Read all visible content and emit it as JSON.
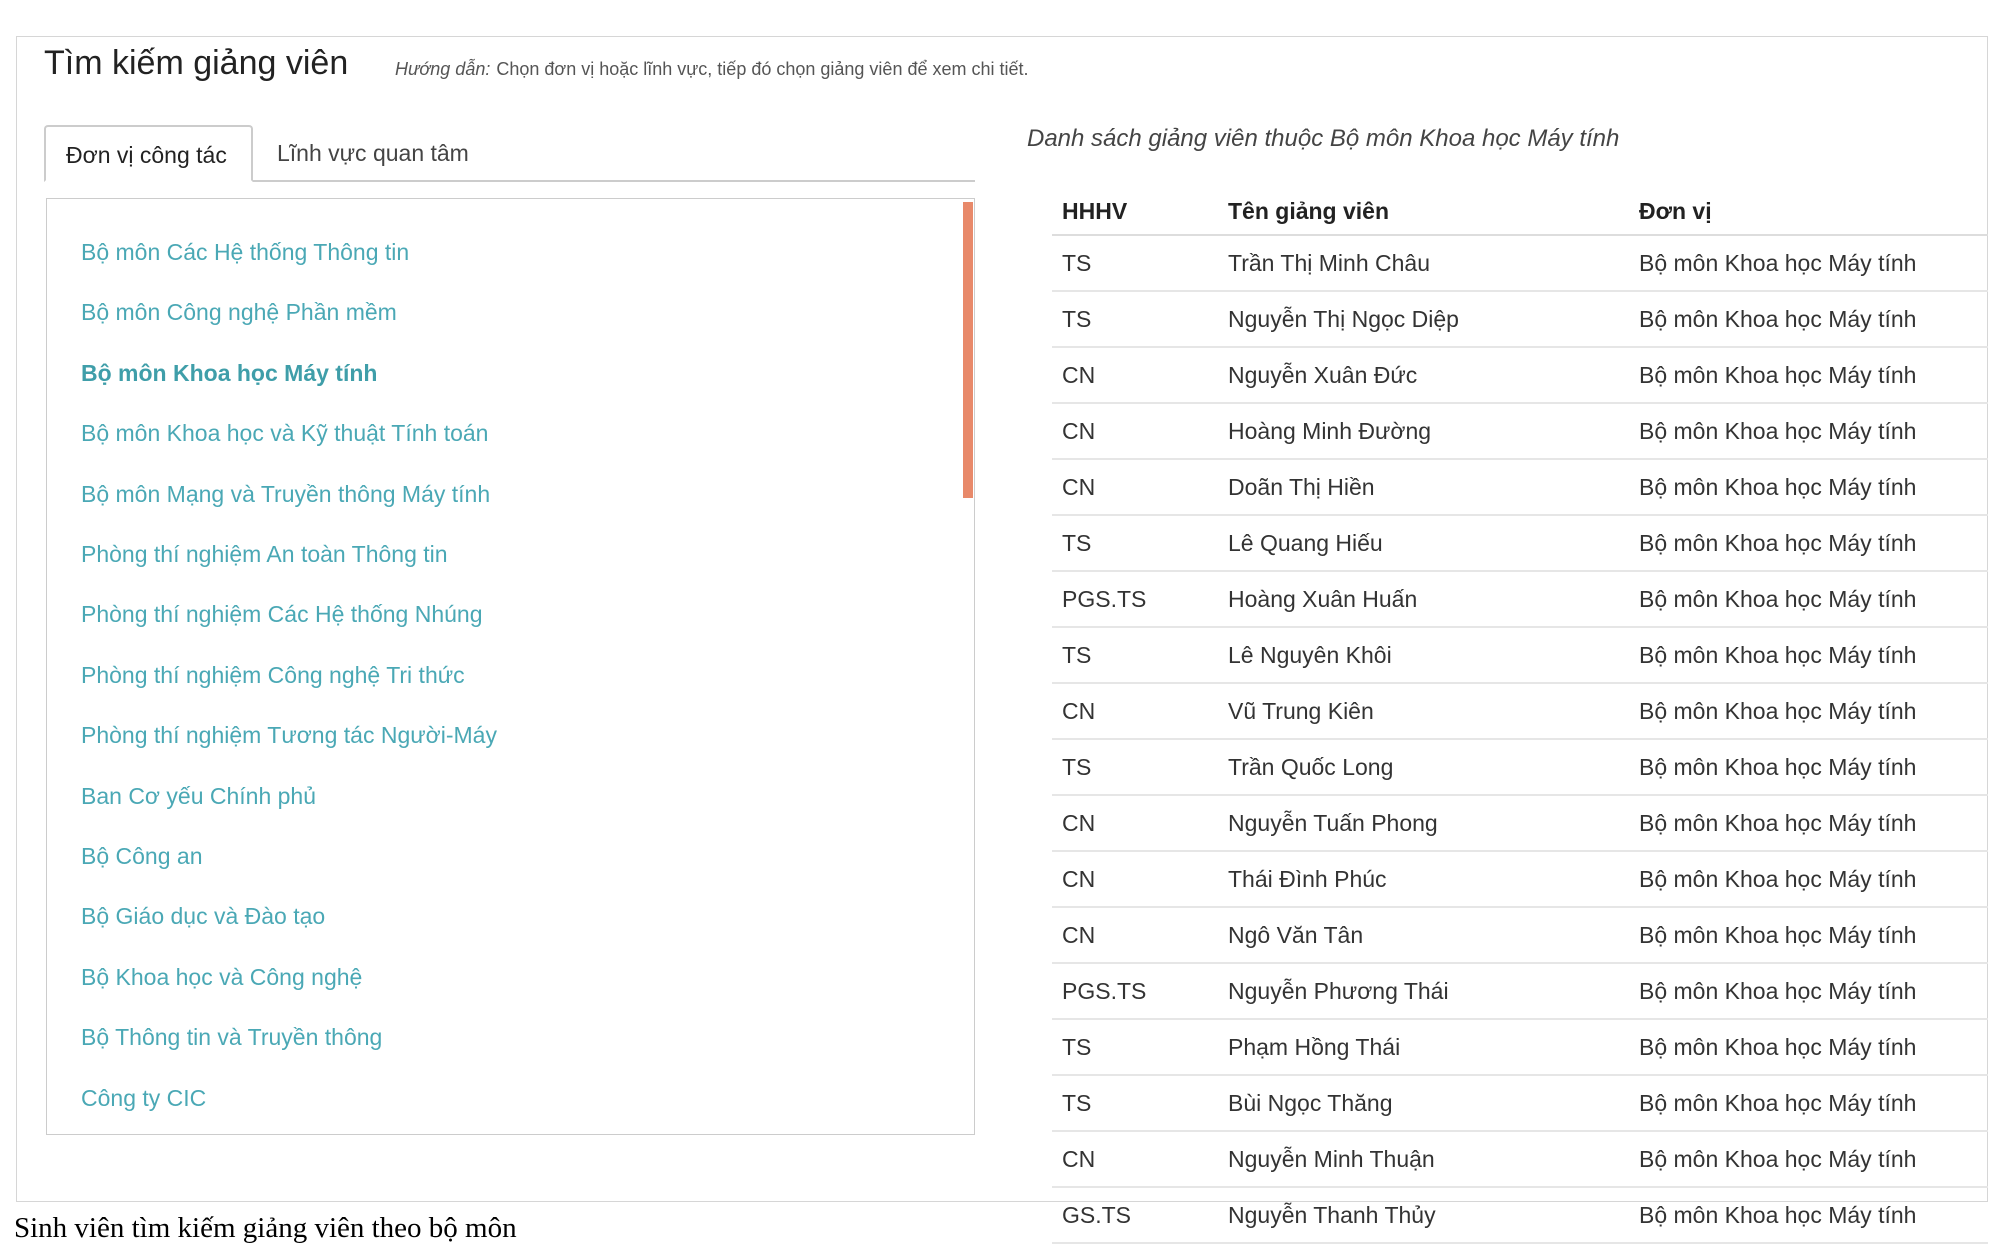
{
  "header": {
    "title": "Tìm kiếm giảng viên",
    "hint_label": "Hướng dẫn:",
    "hint_text": "Chọn đơn vị hoặc lĩnh vực, tiếp đó chọn giảng viên để xem chi tiết."
  },
  "tabs": [
    {
      "label": "Đơn vị công tác",
      "active": true
    },
    {
      "label": "Lĩnh vực quan tâm",
      "active": false
    }
  ],
  "units": [
    "Bộ môn Các Hệ thống Thông tin",
    "Bộ môn Công nghệ Phần mềm",
    "Bộ môn Khoa học Máy tính",
    "Bộ môn Khoa học và Kỹ thuật Tính toán",
    "Bộ môn Mạng và Truyền thông Máy tính",
    "Phòng thí nghiệm An toàn Thông tin",
    "Phòng thí nghiệm Các Hệ thống Nhúng",
    "Phòng thí nghiệm Công nghệ Tri thức",
    "Phòng thí nghiệm Tương tác Người-Máy",
    "Ban Cơ yếu Chính phủ",
    "Bộ Công an",
    "Bộ Giáo dục và Đào tạo",
    "Bộ Khoa học và Công nghệ",
    "Bộ Thông tin và Truyền thông",
    "Công ty CIC"
  ],
  "selected_unit": "Bộ môn Khoa học Máy tính",
  "scroll_color": "#e8896a",
  "link_color": "#4aa8b5",
  "lecturers": {
    "heading": "Danh sách giảng viên thuộc Bộ môn Khoa học Máy tính",
    "columns": [
      "HHHV",
      "Tên giảng viên",
      "Đơn vị"
    ],
    "rows": [
      [
        "TS",
        "Trần Thị Minh Châu",
        "Bộ môn Khoa học Máy tính"
      ],
      [
        "TS",
        "Nguyễn Thị Ngọc Diệp",
        "Bộ môn Khoa học Máy tính"
      ],
      [
        "CN",
        "Nguyễn Xuân Đức",
        "Bộ môn Khoa học Máy tính"
      ],
      [
        "CN",
        "Hoàng Minh Đường",
        "Bộ môn Khoa học Máy tính"
      ],
      [
        "CN",
        "Doãn Thị Hiền",
        "Bộ môn Khoa học Máy tính"
      ],
      [
        "TS",
        "Lê Quang Hiếu",
        "Bộ môn Khoa học Máy tính"
      ],
      [
        "PGS.TS",
        "Hoàng Xuân Huấn",
        "Bộ môn Khoa học Máy tính"
      ],
      [
        "TS",
        "Lê Nguyên Khôi",
        "Bộ môn Khoa học Máy tính"
      ],
      [
        "CN",
        "Vũ Trung Kiên",
        "Bộ môn Khoa học Máy tính"
      ],
      [
        "TS",
        "Trần Quốc Long",
        "Bộ môn Khoa học Máy tính"
      ],
      [
        "CN",
        "Nguyễn Tuấn Phong",
        "Bộ môn Khoa học Máy tính"
      ],
      [
        "CN",
        "Thái Đình Phúc",
        "Bộ môn Khoa học Máy tính"
      ],
      [
        "CN",
        "Ngô Văn Tân",
        "Bộ môn Khoa học Máy tính"
      ],
      [
        "PGS.TS",
        "Nguyễn Phương Thái",
        "Bộ môn Khoa học Máy tính"
      ],
      [
        "TS",
        "Phạm Hồng Thái",
        "Bộ môn Khoa học Máy tính"
      ],
      [
        "TS",
        "Bùi Ngọc Thăng",
        "Bộ môn Khoa học Máy tính"
      ],
      [
        "CN",
        "Nguyễn Minh Thuận",
        "Bộ môn Khoa học Máy tính"
      ],
      [
        "GS.TS",
        "Nguyễn Thanh Thủy",
        "Bộ môn Khoa học Máy tính"
      ]
    ]
  },
  "caption": "Sinh viên tìm kiếm giảng viên theo bộ môn"
}
